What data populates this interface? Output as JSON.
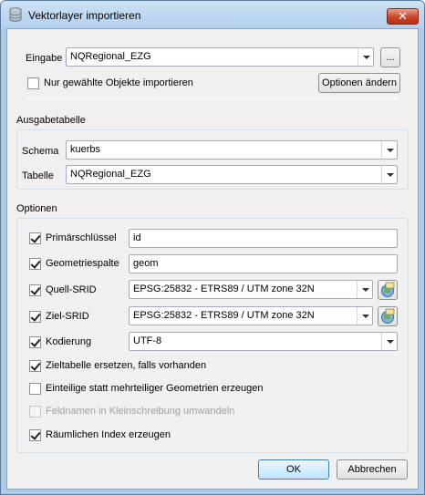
{
  "window": {
    "title": "Vektorlayer importieren",
    "close_glyph": "✕"
  },
  "input_row": {
    "label": "Eingabe",
    "value": "NQRegional_EZG",
    "browse_label": "...",
    "selected_only_label": "Nur gewählte Objekte importieren",
    "selected_only_checked": false,
    "change_options_label": "Optionen ändern"
  },
  "output": {
    "title": "Ausgabetabelle",
    "schema_label": "Schema",
    "schema_value": "kuerbs",
    "table_label": "Tabelle",
    "table_value": "NQRegional_EZG"
  },
  "options": {
    "title": "Optionen",
    "primary_key_label": "Primärschlüssel",
    "primary_key_checked": true,
    "primary_key_value": "id",
    "geometry_column_label": "Geometriespalte",
    "geometry_column_checked": true,
    "geometry_column_value": "geom",
    "source_srid_label": "Quell-SRID",
    "source_srid_checked": true,
    "source_srid_value": "EPSG:25832 - ETRS89 / UTM zone 32N",
    "target_srid_label": "Ziel-SRID",
    "target_srid_checked": true,
    "target_srid_value": "EPSG:25832 - ETRS89 / UTM zone 32N",
    "encoding_label": "Kodierung",
    "encoding_checked": true,
    "encoding_value": "UTF-8",
    "replace_label": "Zieltabelle ersetzen, falls vorhanden",
    "replace_checked": true,
    "single_part_label": "Einteilige statt mehrteiliger Geometrien erzeugen",
    "single_part_checked": false,
    "lowercase_label": "Feldnamen in Kleinschreibung umwandeln",
    "lowercase_checked": false,
    "spatial_index_label": "Räumlichen Index erzeugen",
    "spatial_index_checked": true
  },
  "footer": {
    "ok_label": "OK",
    "cancel_label": "Abbrechen"
  }
}
